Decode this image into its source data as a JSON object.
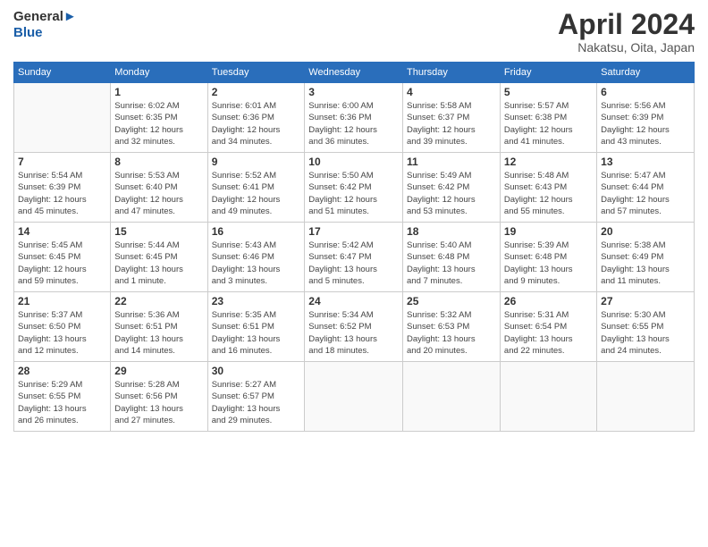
{
  "logo": {
    "general": "General",
    "blue": "Blue"
  },
  "title": "April 2024",
  "subtitle": "Nakatsu, Oita, Japan",
  "weekdays": [
    "Sunday",
    "Monday",
    "Tuesday",
    "Wednesday",
    "Thursday",
    "Friday",
    "Saturday"
  ],
  "weeks": [
    [
      {
        "day": "",
        "detail": ""
      },
      {
        "day": "1",
        "detail": "Sunrise: 6:02 AM\nSunset: 6:35 PM\nDaylight: 12 hours\nand 32 minutes."
      },
      {
        "day": "2",
        "detail": "Sunrise: 6:01 AM\nSunset: 6:36 PM\nDaylight: 12 hours\nand 34 minutes."
      },
      {
        "day": "3",
        "detail": "Sunrise: 6:00 AM\nSunset: 6:36 PM\nDaylight: 12 hours\nand 36 minutes."
      },
      {
        "day": "4",
        "detail": "Sunrise: 5:58 AM\nSunset: 6:37 PM\nDaylight: 12 hours\nand 39 minutes."
      },
      {
        "day": "5",
        "detail": "Sunrise: 5:57 AM\nSunset: 6:38 PM\nDaylight: 12 hours\nand 41 minutes."
      },
      {
        "day": "6",
        "detail": "Sunrise: 5:56 AM\nSunset: 6:39 PM\nDaylight: 12 hours\nand 43 minutes."
      }
    ],
    [
      {
        "day": "7",
        "detail": "Sunrise: 5:54 AM\nSunset: 6:39 PM\nDaylight: 12 hours\nand 45 minutes."
      },
      {
        "day": "8",
        "detail": "Sunrise: 5:53 AM\nSunset: 6:40 PM\nDaylight: 12 hours\nand 47 minutes."
      },
      {
        "day": "9",
        "detail": "Sunrise: 5:52 AM\nSunset: 6:41 PM\nDaylight: 12 hours\nand 49 minutes."
      },
      {
        "day": "10",
        "detail": "Sunrise: 5:50 AM\nSunset: 6:42 PM\nDaylight: 12 hours\nand 51 minutes."
      },
      {
        "day": "11",
        "detail": "Sunrise: 5:49 AM\nSunset: 6:42 PM\nDaylight: 12 hours\nand 53 minutes."
      },
      {
        "day": "12",
        "detail": "Sunrise: 5:48 AM\nSunset: 6:43 PM\nDaylight: 12 hours\nand 55 minutes."
      },
      {
        "day": "13",
        "detail": "Sunrise: 5:47 AM\nSunset: 6:44 PM\nDaylight: 12 hours\nand 57 minutes."
      }
    ],
    [
      {
        "day": "14",
        "detail": "Sunrise: 5:45 AM\nSunset: 6:45 PM\nDaylight: 12 hours\nand 59 minutes."
      },
      {
        "day": "15",
        "detail": "Sunrise: 5:44 AM\nSunset: 6:45 PM\nDaylight: 13 hours\nand 1 minute."
      },
      {
        "day": "16",
        "detail": "Sunrise: 5:43 AM\nSunset: 6:46 PM\nDaylight: 13 hours\nand 3 minutes."
      },
      {
        "day": "17",
        "detail": "Sunrise: 5:42 AM\nSunset: 6:47 PM\nDaylight: 13 hours\nand 5 minutes."
      },
      {
        "day": "18",
        "detail": "Sunrise: 5:40 AM\nSunset: 6:48 PM\nDaylight: 13 hours\nand 7 minutes."
      },
      {
        "day": "19",
        "detail": "Sunrise: 5:39 AM\nSunset: 6:48 PM\nDaylight: 13 hours\nand 9 minutes."
      },
      {
        "day": "20",
        "detail": "Sunrise: 5:38 AM\nSunset: 6:49 PM\nDaylight: 13 hours\nand 11 minutes."
      }
    ],
    [
      {
        "day": "21",
        "detail": "Sunrise: 5:37 AM\nSunset: 6:50 PM\nDaylight: 13 hours\nand 12 minutes."
      },
      {
        "day": "22",
        "detail": "Sunrise: 5:36 AM\nSunset: 6:51 PM\nDaylight: 13 hours\nand 14 minutes."
      },
      {
        "day": "23",
        "detail": "Sunrise: 5:35 AM\nSunset: 6:51 PM\nDaylight: 13 hours\nand 16 minutes."
      },
      {
        "day": "24",
        "detail": "Sunrise: 5:34 AM\nSunset: 6:52 PM\nDaylight: 13 hours\nand 18 minutes."
      },
      {
        "day": "25",
        "detail": "Sunrise: 5:32 AM\nSunset: 6:53 PM\nDaylight: 13 hours\nand 20 minutes."
      },
      {
        "day": "26",
        "detail": "Sunrise: 5:31 AM\nSunset: 6:54 PM\nDaylight: 13 hours\nand 22 minutes."
      },
      {
        "day": "27",
        "detail": "Sunrise: 5:30 AM\nSunset: 6:55 PM\nDaylight: 13 hours\nand 24 minutes."
      }
    ],
    [
      {
        "day": "28",
        "detail": "Sunrise: 5:29 AM\nSunset: 6:55 PM\nDaylight: 13 hours\nand 26 minutes."
      },
      {
        "day": "29",
        "detail": "Sunrise: 5:28 AM\nSunset: 6:56 PM\nDaylight: 13 hours\nand 27 minutes."
      },
      {
        "day": "30",
        "detail": "Sunrise: 5:27 AM\nSunset: 6:57 PM\nDaylight: 13 hours\nand 29 minutes."
      },
      {
        "day": "",
        "detail": ""
      },
      {
        "day": "",
        "detail": ""
      },
      {
        "day": "",
        "detail": ""
      },
      {
        "day": "",
        "detail": ""
      }
    ]
  ]
}
